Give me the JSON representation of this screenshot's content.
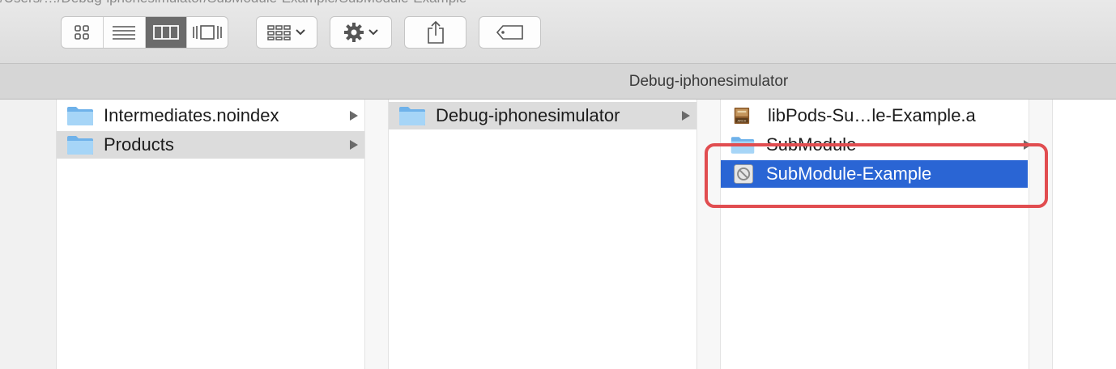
{
  "window": {
    "path_strip_text": "/Users/…/Debug-iphonesimulator/SubModule-Example/SubModule-Example"
  },
  "toolbar": {
    "view_modes": [
      {
        "name": "icon-view",
        "icon": "grid-icon",
        "active": false
      },
      {
        "name": "list-view",
        "icon": "list-icon",
        "active": false
      },
      {
        "name": "column-view",
        "icon": "columns-icon",
        "active": true
      },
      {
        "name": "cover-flow-view",
        "icon": "cover-flow-icon",
        "active": false
      }
    ],
    "arrange_icon": "arrange-grid-icon",
    "action_icon": "gear-icon",
    "share_icon": "share-icon",
    "tags_icon": "tag-icon"
  },
  "path_bar": {
    "title": "Debug-iphonesimulator"
  },
  "columns": [
    {
      "items": [
        {
          "label": "Intermediates.noindex",
          "icon": "folder-icon",
          "has_children": true,
          "state": "none"
        },
        {
          "label": "Products",
          "icon": "folder-icon",
          "has_children": true,
          "state": "selected-inactive"
        }
      ]
    },
    {
      "items": [
        {
          "label": "Debug-iphonesimulator",
          "icon": "folder-icon",
          "has_children": true,
          "state": "selected-inactive"
        }
      ]
    },
    {
      "items": [
        {
          "label": "libPods-Su…le-Example.a",
          "icon": "archive-icon",
          "has_children": false,
          "state": "none"
        },
        {
          "label": "SubModule",
          "icon": "folder-icon",
          "has_children": true,
          "state": "none"
        },
        {
          "label": "SubModule-Example",
          "icon": "app-icon",
          "has_children": false,
          "state": "selected-active"
        }
      ]
    }
  ],
  "colors": {
    "selection_blue": "#2a65d4",
    "selection_gray": "#dcdcdc",
    "annotation_red": "#e14d50",
    "folder_blue": "#8ec7f2"
  }
}
